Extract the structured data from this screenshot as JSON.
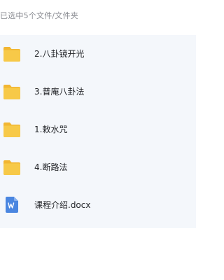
{
  "header": {
    "selection_text": "已选中5个文件/文件夹"
  },
  "items": [
    {
      "label": "2.八卦镜开光",
      "icon": "folder-icon"
    },
    {
      "label": "3.普庵八卦法",
      "icon": "folder-icon"
    },
    {
      "label": "1.敕水咒",
      "icon": "folder-icon"
    },
    {
      "label": "4.断路法",
      "icon": "folder-icon"
    },
    {
      "label": "课程介绍.docx",
      "icon": "word-document-icon"
    }
  ],
  "colors": {
    "folder": "#f7c948",
    "folder_tab": "#f2b632",
    "word": "#4a86e0",
    "list_background": "#f4f7fb"
  }
}
